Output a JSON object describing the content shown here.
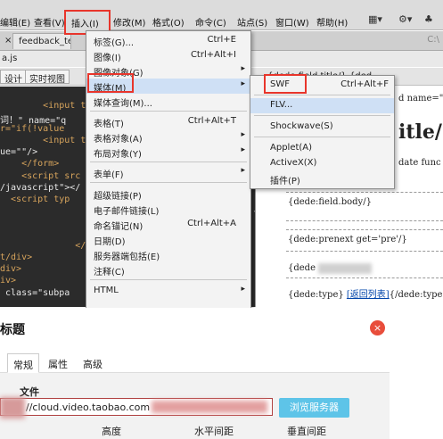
{
  "menubar": {
    "items": [
      "编辑(E)",
      "查看(V)",
      "插入(I)",
      "修改(M)",
      "格式(O)",
      "命令(C)",
      "站点(S)",
      "窗口(W)",
      "帮助(H)"
    ],
    "active_index": 2,
    "right_icons": [
      "layout-icon",
      "gear-icon",
      "extensions-icon"
    ]
  },
  "tabbar": {
    "close_glyph": "×",
    "doc_tab": "feedback_tem",
    "right_text": "C:\\",
    "file_label": "a.js"
  },
  "viewbar": {
    "buttons": [
      "设计",
      "实时视图"
    ],
    "right_text": "{dede:field.title/} {ded"
  },
  "code_lines": [
    {
      "text": "        <input ty",
      "color": "#d7a45c"
    },
    {
      "text": "词！\" name=\"q",
      "color": "#e8e8e8"
    },
    {
      "text": "r=\"if(!value",
      "color": "#d7a45c"
    },
    {
      "text": "        <input ty",
      "color": "#d7a45c"
    },
    {
      "text": "ue=\"\"/>",
      "color": "#e8e8e8"
    },
    {
      "text": "    </form>",
      "color": "#d7a45c"
    },
    {
      "text": "    <script src",
      "color": "#d7a45c"
    },
    {
      "text": "/javascript\"></",
      "color": "#e8e8e8"
    },
    {
      "text": "  <script typ",
      "color": "#d7a45c"
    },
    {
      "text": "                      j",
      "color": "#e8e8e8"
    },
    {
      "text": "",
      "color": "#e8e8e8"
    },
    {
      "text": "              </sc",
      "color": "#d7a45c"
    },
    {
      "text": "t/div>",
      "color": "#d7a45c"
    },
    {
      "text": "div>",
      "color": "#d7a45c"
    },
    {
      "text": "iv>",
      "color": "#d7a45c"
    },
    {
      "text": " class=\"subpa",
      "color": "#e8e8e8"
    }
  ],
  "code_brace": "{",
  "design": {
    "name_attr": "d name=\"",
    "big_title": "itle/}",
    "func_text": "date func",
    "field_body": "{dede:field.body/}",
    "prenext": "{dede:prenext get='pre'/}",
    "dede_short": "{dede",
    "type_prefix": "{dede:type} ",
    "type_link": "[返回列表]",
    "type_suffix": "{/dede:type"
  },
  "insert_menu": {
    "items": [
      {
        "label": "标签(G)...",
        "shortcut": "Ctrl+E",
        "arrow": false
      },
      {
        "label": "图像(I)",
        "shortcut": "Ctrl+Alt+I",
        "arrow": false
      },
      {
        "label": "图像对象(G)",
        "shortcut": "",
        "arrow": true
      },
      {
        "label": "媒体(M)",
        "shortcut": "",
        "arrow": true,
        "highlight": true
      },
      {
        "label": "媒体查询(M)...",
        "shortcut": "",
        "arrow": false
      },
      {
        "label": "表格(T)",
        "shortcut": "Ctrl+Alt+T",
        "arrow": false
      },
      {
        "label": "表格对象(A)",
        "shortcut": "",
        "arrow": true
      },
      {
        "label": "布局对象(Y)",
        "shortcut": "",
        "arrow": true
      },
      {
        "label": "表单(F)",
        "shortcut": "",
        "arrow": true
      },
      {
        "label": "超级链接(P)",
        "shortcut": "",
        "arrow": false
      },
      {
        "label": "电子邮件链接(L)",
        "shortcut": "",
        "arrow": false
      },
      {
        "label": "命名锚记(N)",
        "shortcut": "Ctrl+Alt+A",
        "arrow": false
      },
      {
        "label": "日期(D)",
        "shortcut": "",
        "arrow": false
      },
      {
        "label": "服务器端包括(E)",
        "shortcut": "",
        "arrow": false
      },
      {
        "label": "注释(C)",
        "shortcut": "",
        "arrow": false
      },
      {
        "label": "HTML",
        "shortcut": "",
        "arrow": true
      }
    ]
  },
  "media_submenu": {
    "items": [
      {
        "label": "SWF",
        "shortcut": "Ctrl+Alt+F"
      },
      {
        "label": "FLV...",
        "shortcut": "",
        "highlight": true
      },
      {
        "label": "Shockwave(S)",
        "shortcut": ""
      },
      {
        "label": "Applet(A)",
        "shortcut": ""
      },
      {
        "label": "ActiveX(X)",
        "shortcut": ""
      },
      {
        "label": "插件(P)",
        "shortcut": ""
      }
    ]
  },
  "dialog": {
    "title": "标题",
    "close_glyph": "×",
    "tabs": [
      "常规",
      "属性",
      "高级"
    ],
    "active_tab": 0,
    "file_label": "文件",
    "url_value": "//cloud.video.taobao.com",
    "browse_label": "浏览服务器",
    "size_labels": [
      "高度",
      "水平间距",
      "垂直间距"
    ]
  },
  "colors": {
    "highlight_box": "#e8352b",
    "browse_button": "#5ec4e8",
    "close_button": "#e84d3b"
  }
}
